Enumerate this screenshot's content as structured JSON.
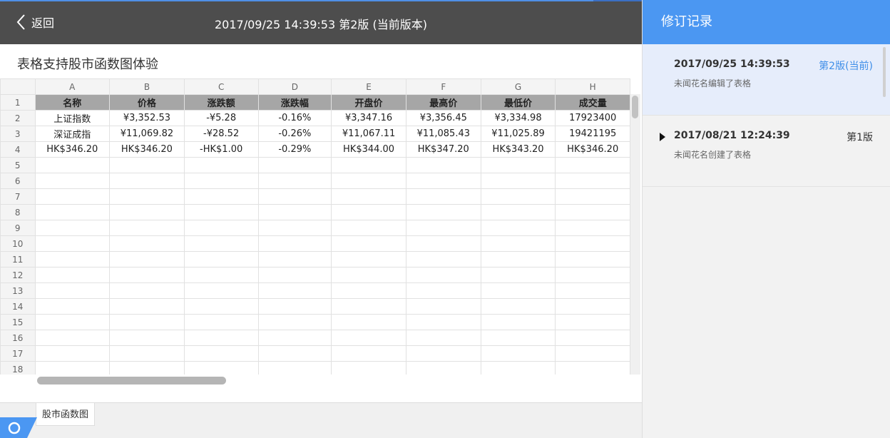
{
  "header": {
    "back_label": "返回",
    "title": "2017/09/25 14:39:53 第2版 (当前版本)"
  },
  "doc": {
    "title": "表格支持股市函数图体验"
  },
  "sheet": {
    "col_headers": [
      "A",
      "B",
      "C",
      "D",
      "E",
      "F",
      "G",
      "H"
    ],
    "row_numbers": [
      "1",
      "2",
      "3",
      "4",
      "5",
      "6",
      "7",
      "8",
      "9",
      "10",
      "11",
      "12",
      "13",
      "14",
      "15",
      "16",
      "17",
      "18"
    ],
    "rows": [
      [
        "名称",
        "价格",
        "涨跌额",
        "涨跌幅",
        "开盘价",
        "最高价",
        "最低价",
        "成交量"
      ],
      [
        "上证指数",
        "¥3,352.53",
        "-¥5.28",
        "-0.16%",
        "¥3,347.16",
        "¥3,356.45",
        "¥3,334.98",
        "17923400"
      ],
      [
        "深证成指",
        "¥11,069.82",
        "-¥28.52",
        "-0.26%",
        "¥11,067.11",
        "¥11,085.43",
        "¥11,025.89",
        "19421195"
      ],
      [
        "HK$346.20",
        "HK$346.20",
        "-HK$1.00",
        "-0.29%",
        "HK$344.00",
        "HK$347.20",
        "HK$343.20",
        "HK$346.20"
      ]
    ]
  },
  "tabs": {
    "active": "股市函数图"
  },
  "panel": {
    "title": "修订记录",
    "revisions": [
      {
        "date": "2017/09/25 14:39:53",
        "version": "第2版(当前)",
        "desc": "未闻花名编辑了表格"
      },
      {
        "date": "2017/08/21 12:24:39",
        "version": "第1版",
        "desc": "未闻花名创建了表格"
      }
    ]
  },
  "colors": {
    "accent": "#4b97f2",
    "header_bg": "#4d4d4d",
    "active_rev_bg": "#e6edfb",
    "table_header_bg": "#a6a6a6"
  }
}
